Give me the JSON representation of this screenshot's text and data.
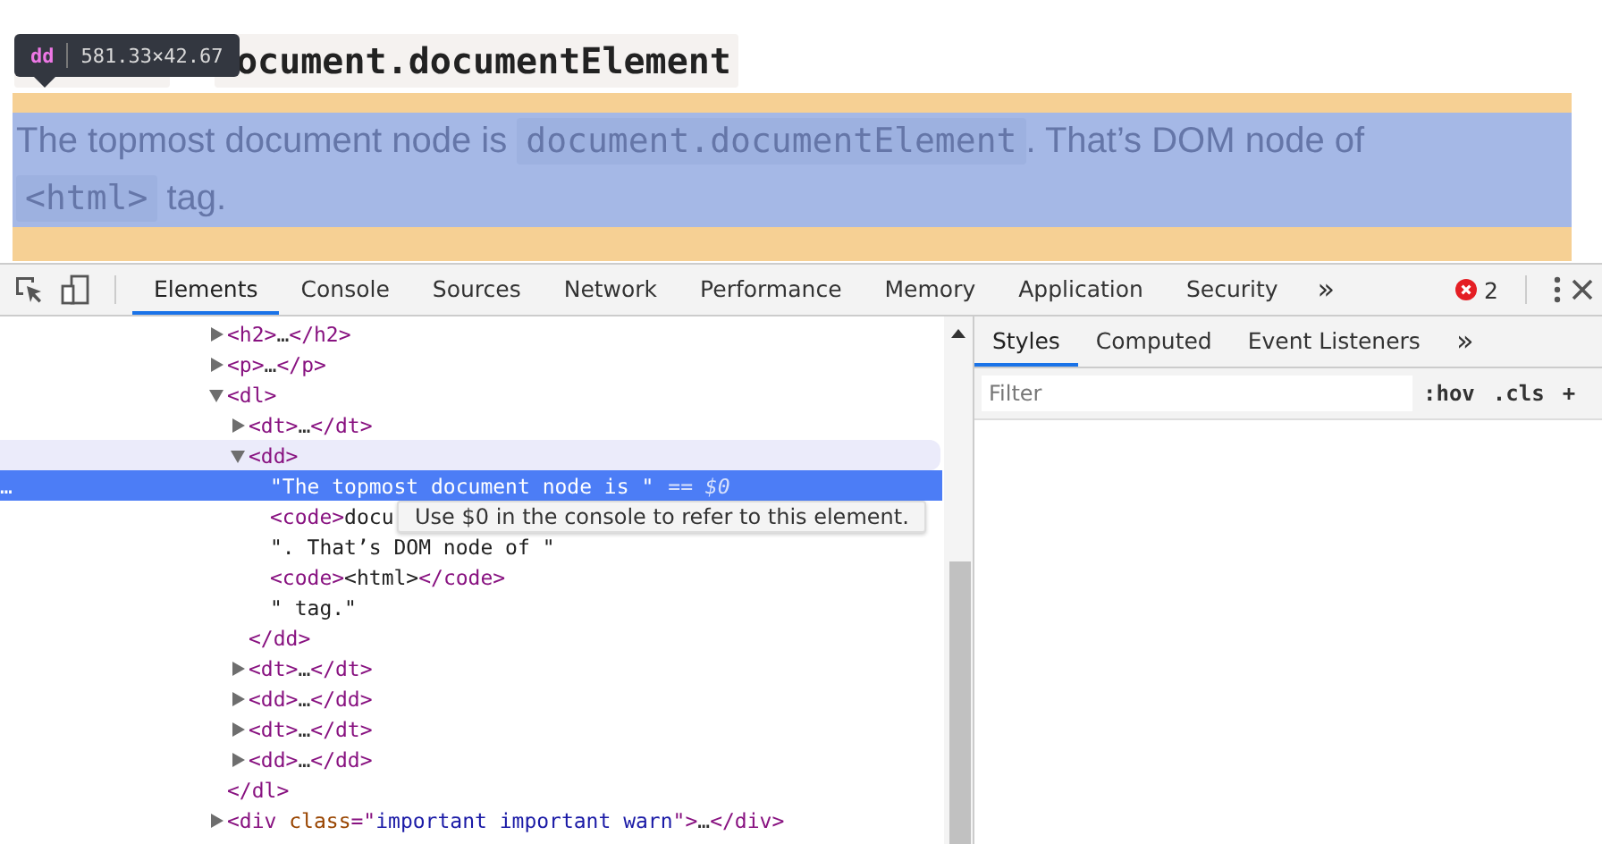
{
  "page": {
    "heading": "ocument.documentElement",
    "paragraph": [
      {
        "kind": "text",
        "text": "The topmost document node is "
      },
      {
        "kind": "code",
        "text": "document.documentElement"
      },
      {
        "kind": "text",
        "text": ". That’s DOM node of "
      },
      {
        "kind": "code",
        "text": "<html>"
      },
      {
        "kind": "text",
        "text": " tag."
      }
    ],
    "element_tooltip": {
      "tag": "dd",
      "size": "581.33×42.67"
    }
  },
  "devtools": {
    "tabs": [
      {
        "label": "Elements",
        "selected": true
      },
      {
        "label": "Console",
        "selected": false
      },
      {
        "label": "Sources",
        "selected": false
      },
      {
        "label": "Network",
        "selected": false
      },
      {
        "label": "Performance",
        "selected": false
      },
      {
        "label": "Memory",
        "selected": false
      },
      {
        "label": "Application",
        "selected": false
      },
      {
        "label": "Security",
        "selected": false
      }
    ],
    "more_tabs": "»",
    "error_count": "2",
    "dom_tree": [
      {
        "tokens": [
          {
            "kind": "tag",
            "text": "<h2>"
          },
          {
            "kind": "ellipsis",
            "text": "…"
          },
          {
            "kind": "tag",
            "text": "</h2>"
          }
        ],
        "expanded": false,
        "selected": false,
        "hovered": false
      },
      {
        "tokens": [
          {
            "kind": "tag",
            "text": "<p>"
          },
          {
            "kind": "ellipsis",
            "text": "…"
          },
          {
            "kind": "tag",
            "text": "</p>"
          }
        ],
        "expanded": false,
        "selected": false,
        "hovered": false
      },
      {
        "tokens": [
          {
            "kind": "tag",
            "text": "<dl>"
          }
        ],
        "expanded": true,
        "selected": false,
        "hovered": false,
        "closing": [
          {
            "kind": "tag",
            "text": "</dl>"
          }
        ],
        "children": [
          {
            "tokens": [
              {
                "kind": "tag",
                "text": "<dt>"
              },
              {
                "kind": "ellipsis",
                "text": "…"
              },
              {
                "kind": "tag",
                "text": "</dt>"
              }
            ],
            "expanded": false,
            "selected": false,
            "hovered": false
          },
          {
            "tokens": [
              {
                "kind": "tag",
                "text": "<dd>"
              }
            ],
            "expanded": true,
            "selected": false,
            "hovered": true,
            "closing": [
              {
                "kind": "tag",
                "text": "</dd>"
              }
            ],
            "children": [
              {
                "tokens": [
                  {
                    "kind": "text",
                    "text": "\"The topmost document node is \""
                  },
                  {
                    "kind": "ref",
                    "text": "== $0"
                  }
                ],
                "selected": true,
                "hovered": false,
                "gutter": "…"
              },
              {
                "tokens": [
                  {
                    "kind": "tag",
                    "text": "<code>"
                  },
                  {
                    "kind": "text",
                    "text": "docu"
                  }
                ],
                "selected": false,
                "hovered": false
              },
              {
                "tokens": [
                  {
                    "kind": "text",
                    "text": "\". That’s DOM node of \""
                  }
                ],
                "selected": false,
                "hovered": false
              },
              {
                "tokens": [
                  {
                    "kind": "tag",
                    "text": "<code>"
                  },
                  {
                    "kind": "text",
                    "text": "<html>"
                  },
                  {
                    "kind": "tag",
                    "text": "</code>"
                  }
                ],
                "selected": false,
                "hovered": false
              },
              {
                "tokens": [
                  {
                    "kind": "text",
                    "text": "\" tag.\""
                  }
                ],
                "selected": false,
                "hovered": false
              }
            ]
          },
          {
            "tokens": [
              {
                "kind": "tag",
                "text": "<dt>"
              },
              {
                "kind": "ellipsis",
                "text": "…"
              },
              {
                "kind": "tag",
                "text": "</dt>"
              }
            ],
            "expanded": false,
            "selected": false,
            "hovered": false
          },
          {
            "tokens": [
              {
                "kind": "tag",
                "text": "<dd>"
              },
              {
                "kind": "ellipsis",
                "text": "…"
              },
              {
                "kind": "tag",
                "text": "</dd>"
              }
            ],
            "expanded": false,
            "selected": false,
            "hovered": false
          },
          {
            "tokens": [
              {
                "kind": "tag",
                "text": "<dt>"
              },
              {
                "kind": "ellipsis",
                "text": "…"
              },
              {
                "kind": "tag",
                "text": "</dt>"
              }
            ],
            "expanded": false,
            "selected": false,
            "hovered": false
          },
          {
            "tokens": [
              {
                "kind": "tag",
                "text": "<dd>"
              },
              {
                "kind": "ellipsis",
                "text": "…"
              },
              {
                "kind": "tag",
                "text": "</dd>"
              }
            ],
            "expanded": false,
            "selected": false,
            "hovered": false
          }
        ]
      },
      {
        "tokens": [
          {
            "kind": "tag",
            "text": "<div "
          },
          {
            "kind": "attr",
            "text": "class"
          },
          {
            "kind": "tag",
            "text": "=\""
          },
          {
            "kind": "value",
            "text": "important important warn"
          },
          {
            "kind": "tag",
            "text": "\">"
          },
          {
            "kind": "ellipsis",
            "text": "…"
          },
          {
            "kind": "tag",
            "text": "</div>"
          }
        ],
        "expanded": false,
        "selected": false,
        "hovered": false
      }
    ],
    "console_hint": "Use $0 in the console to refer to this element.",
    "styles": {
      "tabs": [
        {
          "label": "Styles",
          "selected": true
        },
        {
          "label": "Computed",
          "selected": false
        },
        {
          "label": "Event Listeners",
          "selected": false
        }
      ],
      "more_tabs": "»",
      "filter": {
        "placeholder": "Filter"
      },
      "buttons": [
        ":hov",
        ".cls",
        "+"
      ]
    }
  }
}
